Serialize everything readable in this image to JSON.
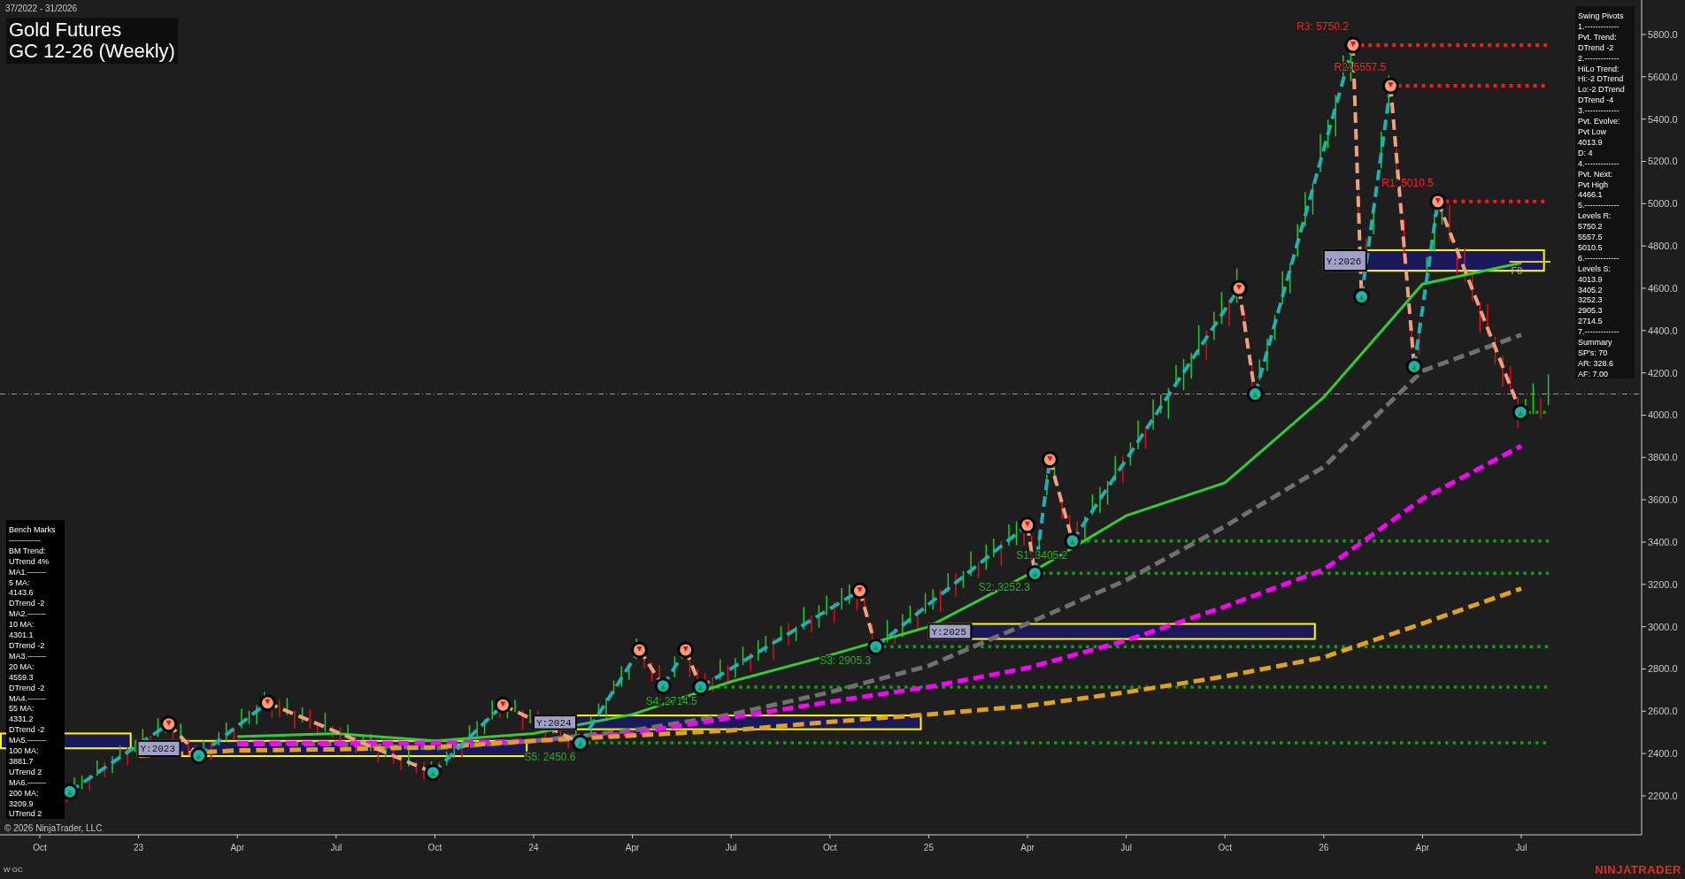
{
  "header": {
    "date_range": "37/2022 - 31/2026",
    "title_lines": [
      "Gold Futures",
      "GC 12-26 (Weekly)"
    ]
  },
  "swing_pivots_panel": {
    "lines": [
      "Swing Pivots",
      "1.-------------",
      "Pvt. Trend:",
      "DTrend -2",
      "2.-------------",
      "HiLo Trend:",
      "Hi:-2 DTrend",
      "Lo:-2 DTrend",
      "DTrend -4",
      "3.-------------",
      "Pvt. Evolve:",
      "Pvt Low",
      "4013.9",
      "D: 4",
      "4.-------------",
      "Pvt. Next:",
      "Pvt High",
      "4466.1",
      "5.-------------",
      "Levels R:",
      "5750.2",
      "5557.5",
      "5010.5",
      "6.-------------",
      "Levels S:",
      "4013.9",
      "3405.2",
      "3252.3",
      "2905.3",
      "2714.5",
      "7.-------------",
      "Summary",
      "SP's: 70",
      "AR: 328.6",
      "AF: 7.00"
    ]
  },
  "bench_marks_panel": {
    "lines": [
      "Bench Marks",
      "------------",
      "BM Trend:",
      "UTrend 4%",
      "MA1.-------",
      "5 MA:",
      "4143.6",
      "DTrend -2",
      "MA2.-------",
      "10 MA:",
      "4301.1",
      "DTrend -2",
      "MA3.-------",
      "20 MA:",
      "4559.3",
      "DTrend -2",
      "MA4.-------",
      "55 MA:",
      "4331.2",
      "DTrend -2",
      "MA5.-------",
      "100 MA:",
      "3881.7",
      "UTrend 2",
      "MA6.-------",
      "200 MA:",
      "3209.9",
      "UTrend 2"
    ]
  },
  "chart": {
    "chart_data": {
      "type": "line",
      "x": [
        "Oct",
        "23",
        "Apr",
        "Jul",
        "Oct",
        "24",
        "Apr",
        "Jul",
        "Oct",
        "25",
        "Apr",
        "Jul",
        "Oct",
        "26",
        "Apr",
        "Jul"
      ],
      "series": [
        {
          "color": "#33cc33",
          "line_style": "solid",
          "values": [
            null,
            null,
            2480,
            2495,
            2460,
            2495,
            2585,
            2740,
            2865,
            3000,
            3245,
            3525,
            3680,
            4085,
            4620,
            4720
          ]
        },
        {
          "color": "#707070",
          "line_style": "dashed",
          "values": [
            null,
            null,
            2445,
            2445,
            2425,
            2460,
            2510,
            2585,
            2690,
            2815,
            3015,
            3220,
            3475,
            3755,
            4210,
            4380
          ]
        },
        {
          "color": "#ff00ff",
          "line_style": "dashed",
          "values": [
            null,
            null,
            2450,
            2450,
            2450,
            2460,
            2495,
            2570,
            2645,
            2715,
            2805,
            2935,
            3095,
            3270,
            3605,
            3855
          ]
        },
        {
          "color": "#e0a020",
          "line_style": "dashed",
          "values": [
            null,
            2390,
            2415,
            2420,
            2430,
            2460,
            2485,
            2510,
            2550,
            2585,
            2625,
            2690,
            2765,
            2855,
            3015,
            3180
          ]
        }
      ],
      "ylim": [
        2016,
        5963
      ],
      "yticks": [
        {
          "value": 2200,
          "label": "2200.0"
        },
        {
          "value": 2400,
          "label": "2400.0"
        },
        {
          "value": 2600,
          "label": "2600.0"
        },
        {
          "value": 2800,
          "label": "2800.0"
        },
        {
          "value": 3000,
          "label": "3000.0"
        },
        {
          "value": 3200,
          "label": "3200.0"
        },
        {
          "value": 3400,
          "label": "3400.0"
        },
        {
          "value": 3600,
          "label": "3600.0"
        },
        {
          "value": 3800,
          "label": "3800.0"
        },
        {
          "value": 4000,
          "label": "4000.0"
        },
        {
          "value": 4200,
          "label": "4200.0"
        },
        {
          "value": 4400,
          "label": "4400.0"
        },
        {
          "value": 4600,
          "label": "4600.0"
        },
        {
          "value": 4800,
          "label": "4800.0"
        },
        {
          "value": 5000,
          "label": "5000.0"
        },
        {
          "value": 5200,
          "label": "5200.0"
        },
        {
          "value": 5400,
          "label": "5400.0"
        },
        {
          "value": 5600,
          "label": "5600.0"
        },
        {
          "value": 5800,
          "label": "5800.0"
        }
      ]
    },
    "levels": [
      {
        "kind": "resistance",
        "text": "R3: 5750.2"
      },
      {
        "kind": "resistance",
        "text": "R2: 5557.5"
      },
      {
        "kind": "resistance",
        "text": "R1: 5010.5"
      },
      {
        "kind": "support"
      },
      {
        "kind": "support",
        "text": "S1: 3405.2"
      },
      {
        "kind": "support",
        "text": "S2: 3252.3"
      },
      {
        "kind": "support",
        "text": "S3: 2905.3"
      },
      {
        "kind": "support",
        "text": "S4: 2714.5"
      },
      {
        "kind": "support",
        "text": "S5: 2450.6"
      }
    ],
    "year_boxes": [
      {
        "label": "Y:2023"
      },
      {
        "label": "Y:2024"
      },
      {
        "label": "Y:2025"
      },
      {
        "label": "Y:2026"
      }
    ],
    "fib_label": "F0"
  },
  "copyright": "© 2026 NinjaTrader, LLC",
  "instrument_label": "W GC",
  "logo": "NINJATRADER"
}
